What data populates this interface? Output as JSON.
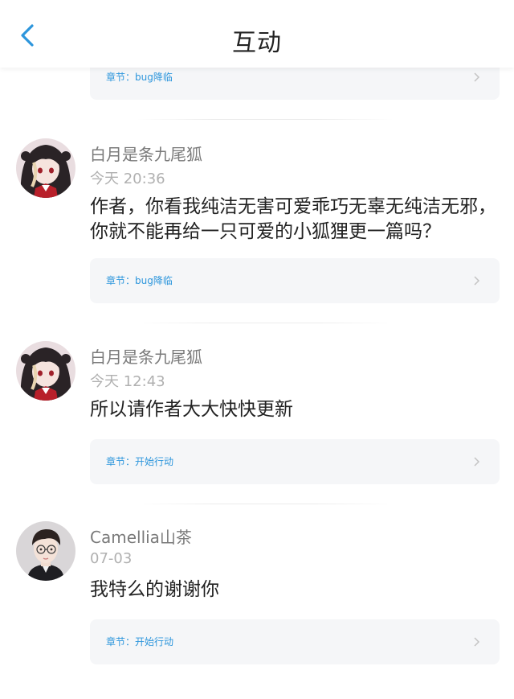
{
  "header": {
    "title": "互动",
    "back_icon": "chevron-left-icon"
  },
  "top_card": {
    "chapter_label": "章节：bug降临"
  },
  "comments": [
    {
      "username": "白月是条九尾狐",
      "time": "今天 20:36",
      "content": "作者，你看我纯洁无害可爱乖巧无辜无纯洁无邪，你就不能再给一只可爱的小狐狸更一篇吗？",
      "chapter_label": "章节：bug降临"
    },
    {
      "username": "白月是条九尾狐",
      "time": "今天 12:43",
      "content": "所以请作者大大快快更新",
      "chapter_label": "章节：开始行动"
    },
    {
      "username": "Camellia山茶",
      "time": "07-03",
      "content": "我特么的谢谢你",
      "chapter_label": "章节：开始行动"
    }
  ],
  "colors": {
    "accent": "#2d96dc",
    "card_bg": "#f5f6f8",
    "username": "#7a7a7a",
    "timestamp": "#b0b0b0"
  }
}
